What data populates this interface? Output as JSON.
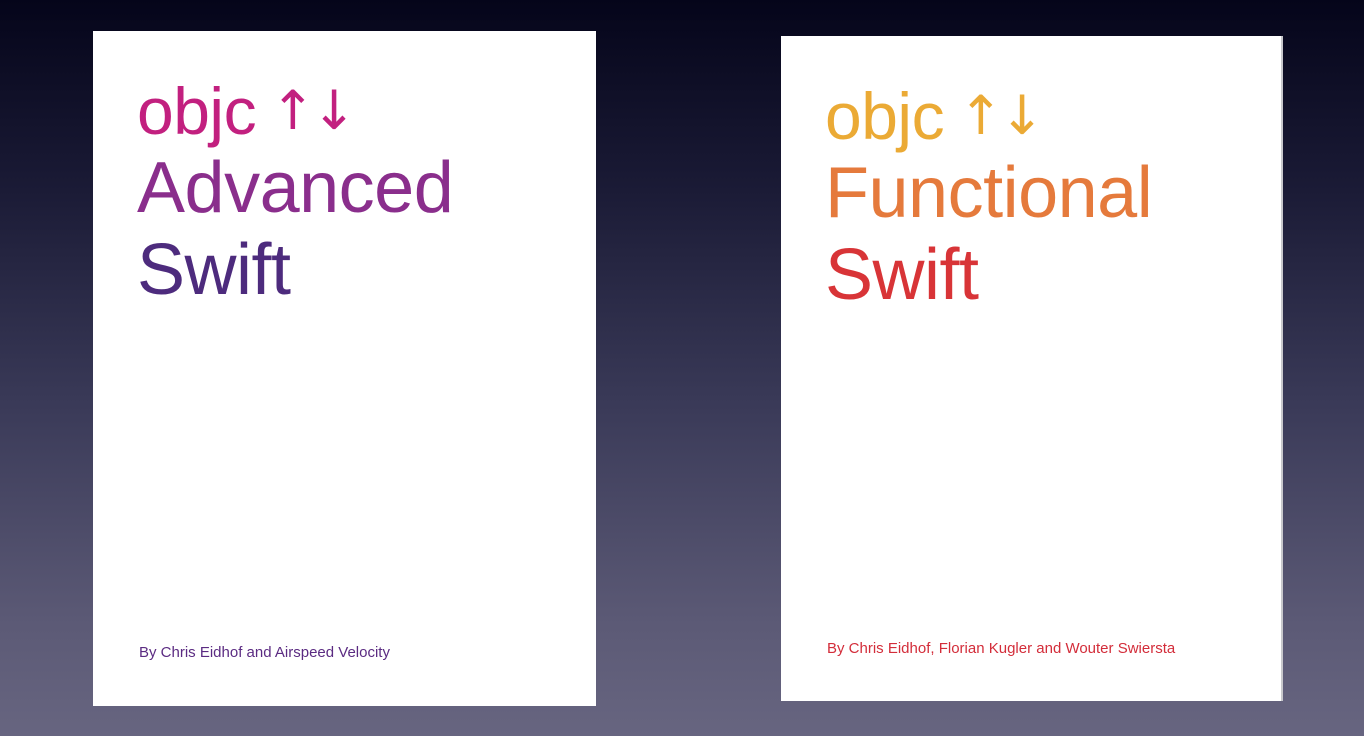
{
  "books": [
    {
      "brand": "objc",
      "arrows": "↑↓",
      "title_line_1": "Advanced",
      "title_line_2": "Swift",
      "byline": "By Chris Eidhof and Airspeed Velocity"
    },
    {
      "brand": "objc",
      "arrows": "↑↓",
      "title_line_1": "Functional",
      "title_line_2": "Swift",
      "byline": "By Chris Eidhof, Florian Kugler and Wouter Swiersta"
    }
  ],
  "colors": {
    "left_brand": "#c2207f",
    "left_title": "#4d2b7d",
    "right_brand": "#ebaa35",
    "right_title": "#d83437"
  }
}
